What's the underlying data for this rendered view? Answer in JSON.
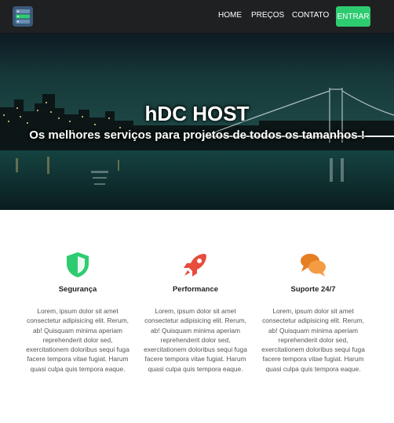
{
  "navbar": {
    "logo_icon": "server-stack-icon",
    "links": [
      {
        "label": "HOME"
      },
      {
        "label": "PREÇOS"
      },
      {
        "label": "CONTATO"
      }
    ],
    "cta_label": "ENTRAR",
    "cta_color": "#2ecc71",
    "background": "#1f2022"
  },
  "hero": {
    "title": "hDC HOST",
    "subtitle": "Os melhores serviços para projetos de todos os tamanhos !",
    "background_image": "city-skyline-night-bridge"
  },
  "features": [
    {
      "icon": "shield-icon",
      "icon_color": "#2ecc71",
      "title": "Segurança",
      "text": "Lorem, ipsum dolor sit amet consectetur adipisicing elit. Rerum, ab! Quisquam minima aperiam reprehenderit dolor sed, exercitationem doloribus sequi fuga facere tempora vitae fugiat. Harum quasi culpa quis tempora eaque."
    },
    {
      "icon": "rocket-icon",
      "icon_color": "#e74c3c",
      "title": "Performance",
      "text": "Lorem, ipsum dolor sit amet consectetur adipisicing elit. Rerum, ab! Quisquam minima aperiam reprehenderit dolor sed, exercitationem doloribus sequi fuga facere tempora vitae fugiat. Harum quasi culpa quis tempora eaque."
    },
    {
      "icon": "chat-bubbles-icon",
      "icon_color": "#e67e22",
      "title": "Suporte 24/7",
      "text": "Lorem, ipsum dolor sit amet consectetur adipisicing elit. Rerum, ab! Quisquam minima aperiam reprehenderit dolor sed, exercitationem doloribus sequi fuga facere tempora vitae fugiat. Harum quasi culpa quis tempora eaque."
    }
  ]
}
